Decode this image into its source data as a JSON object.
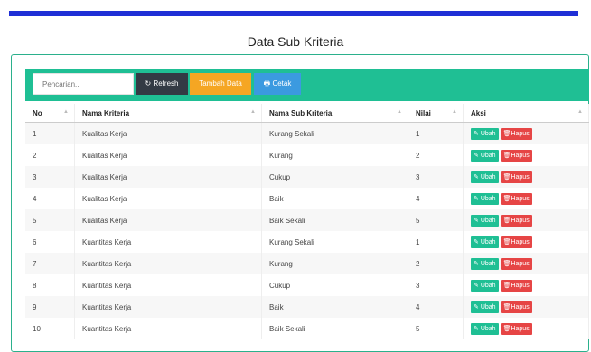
{
  "page": {
    "title": "Data Sub Kriteria"
  },
  "toolbar": {
    "search_placeholder": "Pencarian...",
    "refresh": "Refresh",
    "tambah": "Tambah Data",
    "cetak": "Cetak"
  },
  "table": {
    "headers": [
      "No",
      "Nama Kriteria",
      "Nama Sub Kriteria",
      "Nilai",
      "Aksi"
    ],
    "rows": [
      {
        "no": "1",
        "kriteria": "Kualitas Kerja",
        "sub": "Kurang Sekali",
        "nilai": "1"
      },
      {
        "no": "2",
        "kriteria": "Kualitas Kerja",
        "sub": "Kurang",
        "nilai": "2"
      },
      {
        "no": "3",
        "kriteria": "Kualitas Kerja",
        "sub": "Cukup",
        "nilai": "3"
      },
      {
        "no": "4",
        "kriteria": "Kualitas Kerja",
        "sub": "Baik",
        "nilai": "4"
      },
      {
        "no": "5",
        "kriteria": "Kualitas Kerja",
        "sub": "Baik Sekali",
        "nilai": "5"
      },
      {
        "no": "6",
        "kriteria": "Kuantitas Kerja",
        "sub": "Kurang Sekali",
        "nilai": "1"
      },
      {
        "no": "7",
        "kriteria": "Kuantitas Kerja",
        "sub": "Kurang",
        "nilai": "2"
      },
      {
        "no": "8",
        "kriteria": "Kuantitas Kerja",
        "sub": "Cukup",
        "nilai": "3"
      },
      {
        "no": "9",
        "kriteria": "Kuantitas Kerja",
        "sub": "Baik",
        "nilai": "4"
      },
      {
        "no": "10",
        "kriteria": "Kuantitas Kerja",
        "sub": "Baik Sekali",
        "nilai": "5"
      }
    ],
    "ubah_label": "Ubah",
    "hapus_label": "Hapus"
  },
  "colors": {
    "primary": "#1fbf94",
    "danger": "#e64545",
    "warning": "#f5a623",
    "info": "#3b9ae0",
    "dark": "#333a44",
    "bar": "#1f2fd6"
  },
  "icons": {
    "refresh": "refresh-icon",
    "print": "print-icon",
    "edit": "edit-icon",
    "trash": "trash-icon"
  }
}
